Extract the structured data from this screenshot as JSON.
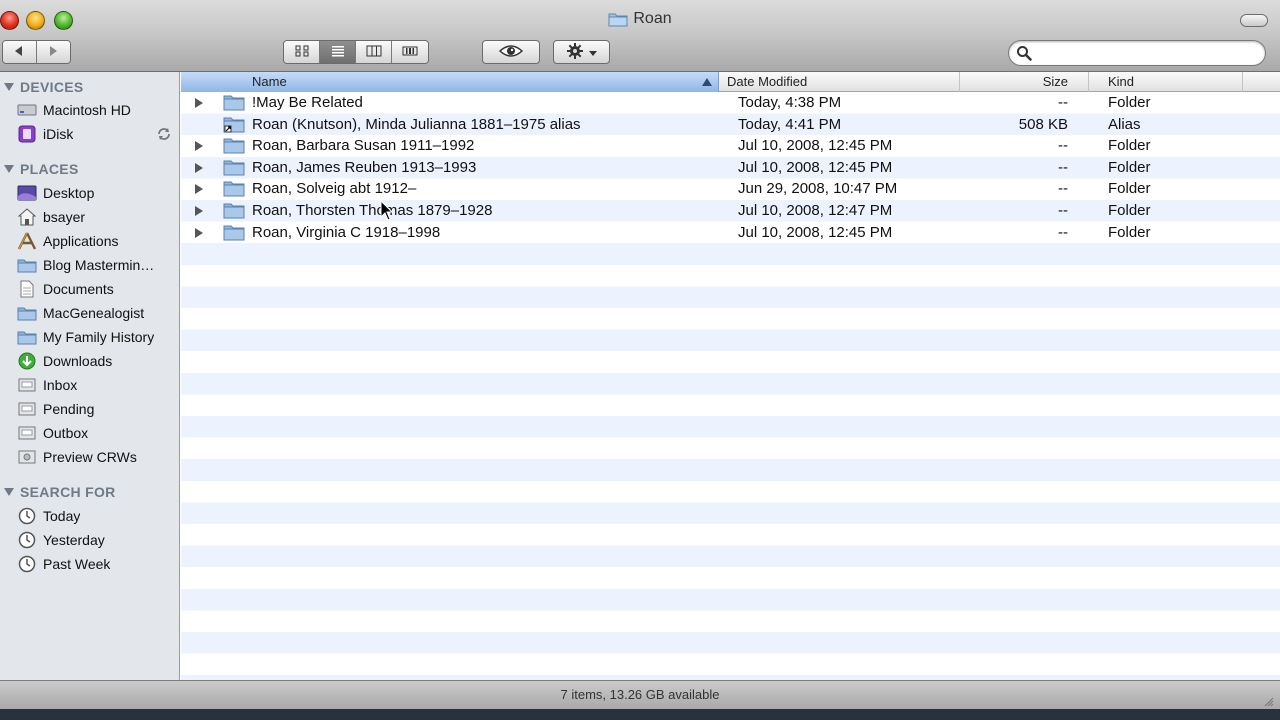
{
  "window": {
    "title": "Roan"
  },
  "toolbar": {
    "back_icon": "back-arrow-icon",
    "forward_icon": "forward-arrow-icon",
    "view_modes": [
      "icon-view",
      "list-view",
      "column-view",
      "cover-flow-view"
    ],
    "active_view": "list-view",
    "quicklook_icon": "eye-icon",
    "action_icon": "gear-icon",
    "search_placeholder": "",
    "search_value": ""
  },
  "sidebar": {
    "devices_header": "DEVICES",
    "devices": [
      {
        "label": "Macintosh HD",
        "icon": "hard-drive-icon"
      },
      {
        "label": "iDisk",
        "icon": "idisk-icon"
      }
    ],
    "places_header": "PLACES",
    "places": [
      {
        "label": "Desktop",
        "icon": "desktop-icon"
      },
      {
        "label": "bsayer",
        "icon": "home-icon"
      },
      {
        "label": "Applications",
        "icon": "applications-icon"
      },
      {
        "label": "Blog Mastermin…",
        "icon": "folder-icon"
      },
      {
        "label": "Documents",
        "icon": "documents-icon"
      },
      {
        "label": "MacGenealogist",
        "icon": "folder-icon"
      },
      {
        "label": "My Family History",
        "icon": "folder-icon"
      },
      {
        "label": "Downloads",
        "icon": "downloads-icon"
      },
      {
        "label": "Inbox",
        "icon": "folder-icon"
      },
      {
        "label": "Pending",
        "icon": "folder-icon"
      },
      {
        "label": "Outbox",
        "icon": "folder-icon"
      },
      {
        "label": "Preview CRWs",
        "icon": "folder-icon"
      }
    ],
    "search_header": "SEARCH FOR",
    "searches": [
      {
        "label": "Today",
        "icon": "clock-icon"
      },
      {
        "label": "Yesterday",
        "icon": "clock-icon"
      },
      {
        "label": "Past Week",
        "icon": "clock-icon"
      }
    ]
  },
  "list": {
    "columns": {
      "name": "Name",
      "date": "Date Modified",
      "size": "Size",
      "kind": "Kind"
    },
    "rows": [
      {
        "name": "!May Be Related",
        "date": "Today, 4:38 PM",
        "size": "--",
        "kind": "Folder",
        "expandable": true,
        "alias": false
      },
      {
        "name": "Roan (Knutson), Minda Julianna 1881–1975 alias",
        "date": "Today, 4:41 PM",
        "size": "508 KB",
        "kind": "Alias",
        "expandable": false,
        "alias": true
      },
      {
        "name": "Roan, Barbara Susan 1911–1992",
        "date": "Jul 10, 2008, 12:45 PM",
        "size": "--",
        "kind": "Folder",
        "expandable": true,
        "alias": false
      },
      {
        "name": "Roan, James Reuben 1913–1993",
        "date": "Jul 10, 2008, 12:45 PM",
        "size": "--",
        "kind": "Folder",
        "expandable": true,
        "alias": false
      },
      {
        "name": "Roan, Solveig abt 1912–",
        "date": "Jun 29, 2008, 10:47 PM",
        "size": "--",
        "kind": "Folder",
        "expandable": true,
        "alias": false
      },
      {
        "name": "Roan, Thorsten Thomas 1879–1928",
        "date": "Jul 10, 2008, 12:47 PM",
        "size": "--",
        "kind": "Folder",
        "expandable": true,
        "alias": false
      },
      {
        "name": "Roan, Virginia C 1918–1998",
        "date": "Jul 10, 2008, 12:45 PM",
        "size": "--",
        "kind": "Folder",
        "expandable": true,
        "alias": false
      }
    ]
  },
  "status": {
    "text": "7 items, 13.26 GB available"
  },
  "colors": {
    "sidebar_bg": "#e3e7ec",
    "header_sort_blue": "#8fb6e8",
    "stripe": "#edf3fe",
    "sidebar_header": "#6f7a86"
  }
}
